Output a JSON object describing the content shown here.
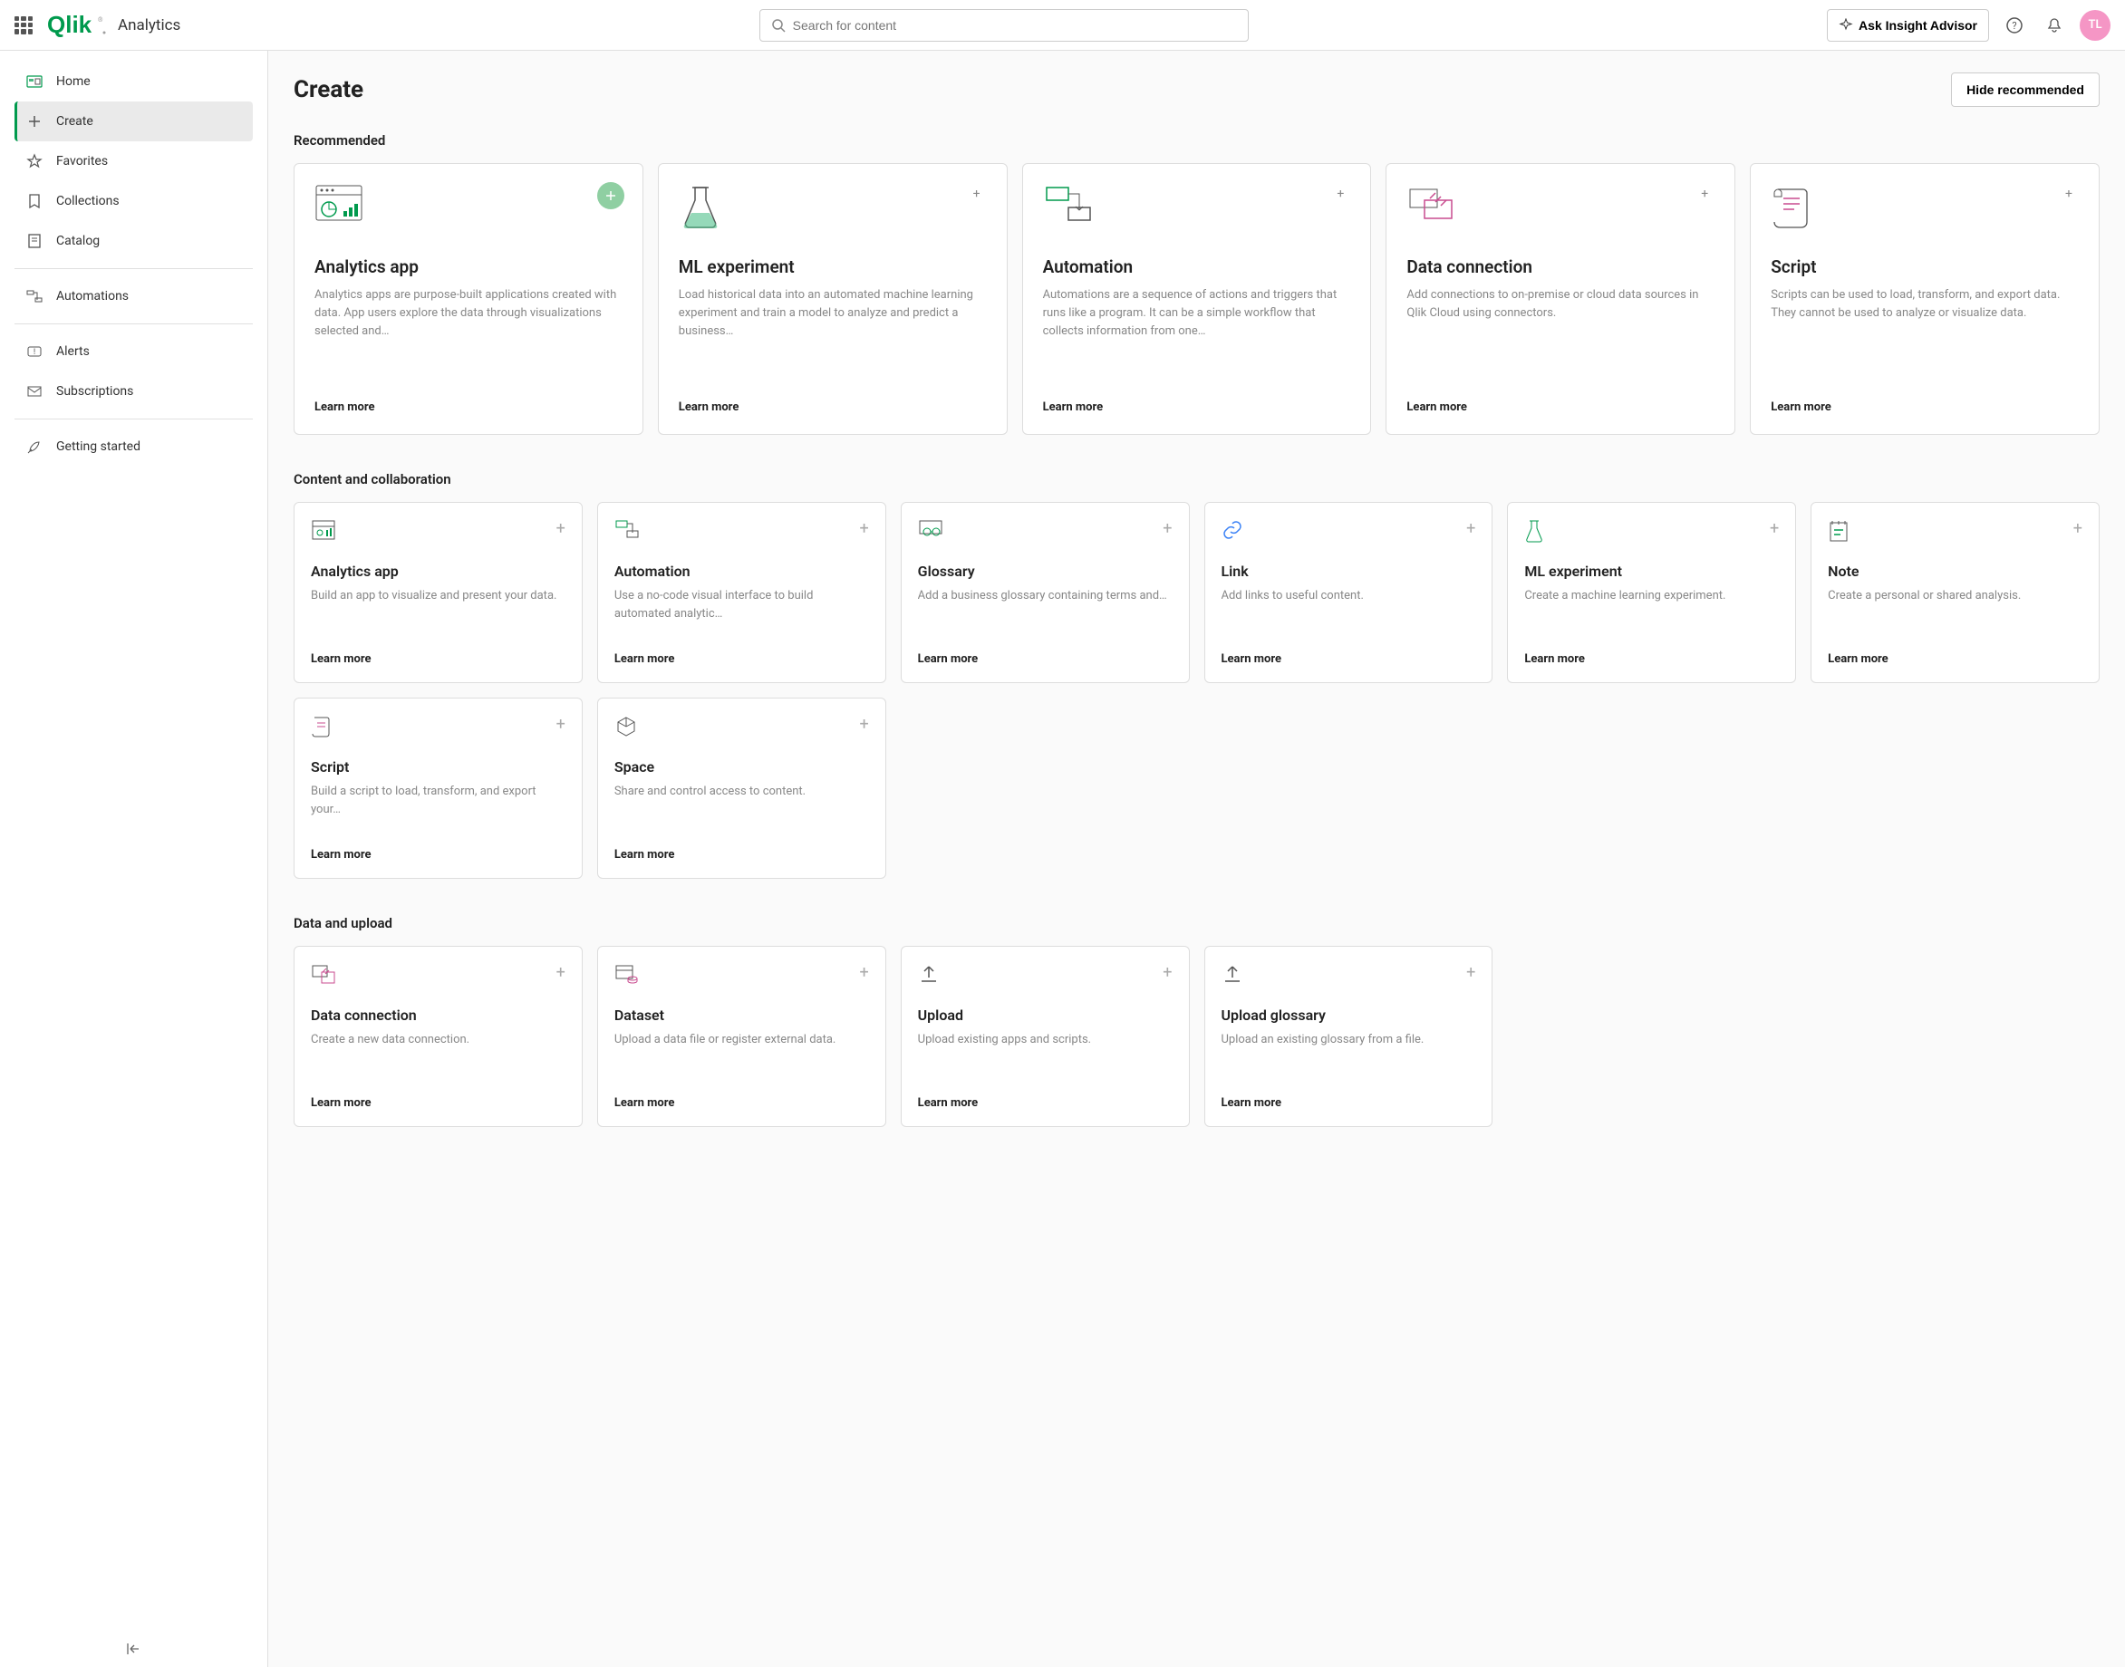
{
  "header": {
    "brand": "Qlik",
    "module": "Analytics",
    "search_placeholder": "Search for content",
    "insight_label": "Ask Insight Advisor",
    "avatar": "TL"
  },
  "sidebar": {
    "items": [
      {
        "label": "Home"
      },
      {
        "label": "Create",
        "active": true
      },
      {
        "label": "Favorites"
      },
      {
        "label": "Collections"
      },
      {
        "label": "Catalog"
      }
    ],
    "secondary": [
      {
        "label": "Automations"
      }
    ],
    "tertiary": [
      {
        "label": "Alerts"
      },
      {
        "label": "Subscriptions"
      }
    ],
    "footer": [
      {
        "label": "Getting started"
      }
    ]
  },
  "page": {
    "title": "Create",
    "hide": "Hide recommended",
    "recommended_title": "Recommended",
    "content_title": "Content and collaboration",
    "data_title": "Data and upload",
    "learn_more": "Learn more"
  },
  "recommended": [
    {
      "title": "Analytics app",
      "desc": "Analytics apps are purpose-built applications created with data. App users explore the data through visualizations selected and…"
    },
    {
      "title": "ML experiment",
      "desc": "Load historical data into an automated machine learning experiment and train a model to analyze and predict a business…"
    },
    {
      "title": "Automation",
      "desc": "Automations are a sequence of actions and triggers that runs like a program. It can be a simple workflow that collects information from one…"
    },
    {
      "title": "Data connection",
      "desc": "Add connections to on-premise or cloud data sources in Qlik Cloud using connectors."
    },
    {
      "title": "Script",
      "desc": "Scripts can be used to load, transform, and export data. They cannot be used to analyze or visualize data."
    }
  ],
  "content": [
    {
      "title": "Analytics app",
      "desc": "Build an app to visualize and present your data."
    },
    {
      "title": "Automation",
      "desc": "Use a no-code visual interface to build automated analytic…"
    },
    {
      "title": "Glossary",
      "desc": "Add a business glossary containing terms and…"
    },
    {
      "title": "Link",
      "desc": "Add links to useful content."
    },
    {
      "title": "ML experiment",
      "desc": "Create a machine learning experiment."
    },
    {
      "title": "Note",
      "desc": "Create a personal or shared analysis."
    },
    {
      "title": "Script",
      "desc": "Build a script to load, transform, and export your…"
    },
    {
      "title": "Space",
      "desc": "Share and control access to content."
    }
  ],
  "data": [
    {
      "title": "Data connection",
      "desc": "Create a new data connection."
    },
    {
      "title": "Dataset",
      "desc": "Upload a data file or register external data."
    },
    {
      "title": "Upload",
      "desc": "Upload existing apps and scripts."
    },
    {
      "title": "Upload glossary",
      "desc": "Upload an existing glossary from a file."
    }
  ]
}
